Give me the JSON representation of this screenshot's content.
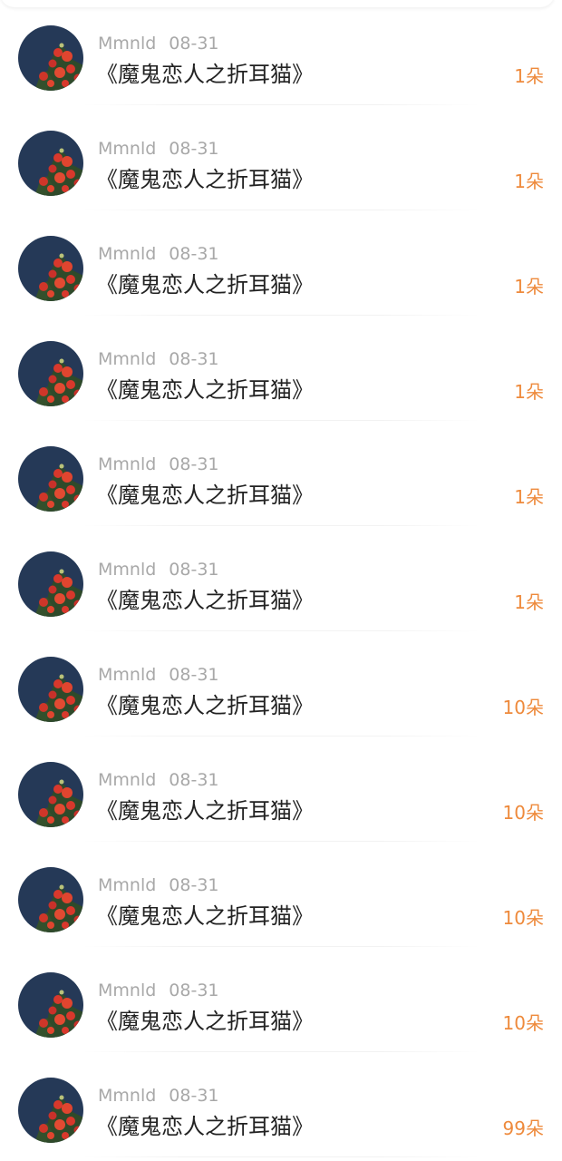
{
  "gifts": [
    {
      "user": "Mmnld",
      "date": "08-31",
      "title": "《魔鬼恋人之折耳猫》",
      "amount": "1朵"
    },
    {
      "user": "Mmnld",
      "date": "08-31",
      "title": "《魔鬼恋人之折耳猫》",
      "amount": "1朵"
    },
    {
      "user": "Mmnld",
      "date": "08-31",
      "title": "《魔鬼恋人之折耳猫》",
      "amount": "1朵"
    },
    {
      "user": "Mmnld",
      "date": "08-31",
      "title": "《魔鬼恋人之折耳猫》",
      "amount": "1朵"
    },
    {
      "user": "Mmnld",
      "date": "08-31",
      "title": "《魔鬼恋人之折耳猫》",
      "amount": "1朵"
    },
    {
      "user": "Mmnld",
      "date": "08-31",
      "title": "《魔鬼恋人之折耳猫》",
      "amount": "1朵"
    },
    {
      "user": "Mmnld",
      "date": "08-31",
      "title": "《魔鬼恋人之折耳猫》",
      "amount": "10朵"
    },
    {
      "user": "Mmnld",
      "date": "08-31",
      "title": "《魔鬼恋人之折耳猫》",
      "amount": "10朵"
    },
    {
      "user": "Mmnld",
      "date": "08-31",
      "title": "《魔鬼恋人之折耳猫》",
      "amount": "10朵"
    },
    {
      "user": "Mmnld",
      "date": "08-31",
      "title": "《魔鬼恋人之折耳猫》",
      "amount": "10朵"
    },
    {
      "user": "Mmnld",
      "date": "08-31",
      "title": "《魔鬼恋人之折耳猫》",
      "amount": "99朵"
    }
  ],
  "colors": {
    "amount": "#ee8a3c",
    "meta": "#a8a8a8",
    "title": "#222222",
    "avatar_sky": "#253957",
    "avatar_flowers": "#d8382c",
    "avatar_leaves": "#2f4a2a"
  },
  "avatar_icon": "rose-avatar-icon"
}
